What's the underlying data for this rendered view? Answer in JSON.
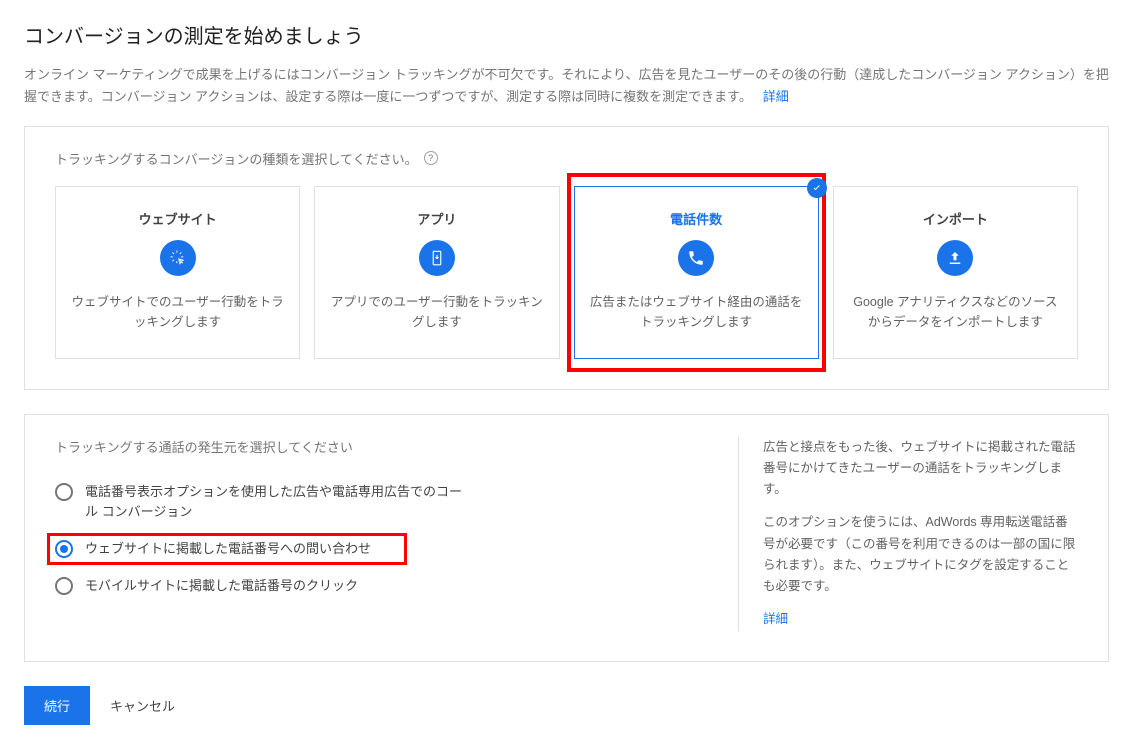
{
  "title": "コンバージョンの測定を始めましょう",
  "intro": "オンライン マーケティングで成果を上げるにはコンバージョン トラッキングが不可欠です。それにより、広告を見たユーザーのその後の行動（達成したコンバージョン アクション）を把握できます。コンバージョン アクションは、設定する際は一度に一つずつですが、測定する際は同時に複数を測定できます。",
  "intro_link": "詳細",
  "section1_label": "トラッキングするコンバージョンの種類を選択してください。",
  "cards": [
    {
      "title": "ウェブサイト",
      "desc": "ウェブサイトでのユーザー行動をトラッキングします",
      "icon": "cursor-click-icon"
    },
    {
      "title": "アプリ",
      "desc": "アプリでのユーザー行動をトラッキングします",
      "icon": "phone-download-icon"
    },
    {
      "title": "電話件数",
      "desc": "広告またはウェブサイト経由の通話をトラッキングします",
      "icon": "phone-call-icon",
      "selected": true
    },
    {
      "title": "インポート",
      "desc": "Google アナリティクスなどのソースからデータをインポートします",
      "icon": "upload-icon"
    }
  ],
  "section2_label": "トラッキングする通話の発生元を選択してください",
  "radios": [
    {
      "label": "電話番号表示オプションを使用した広告や電話専用広告でのコール コンバージョン",
      "checked": false
    },
    {
      "label": "ウェブサイトに掲載した電話番号への問い合わせ",
      "checked": true,
      "highlight": true
    },
    {
      "label": "モバイルサイトに掲載した電話番号のクリック",
      "checked": false
    }
  ],
  "aside": {
    "p1": "広告と接点をもった後、ウェブサイトに掲載された電話番号にかけてきたユーザーの通話をトラッキングします。",
    "p2": "このオプションを使うには、AdWords 専用転送電話番号が必要です（この番号を利用できるのは一部の国に限られます）。また、ウェブサイトにタグを設定することも必要です。",
    "link": "詳細"
  },
  "footer": {
    "continue": "続行",
    "cancel": "キャンセル"
  }
}
